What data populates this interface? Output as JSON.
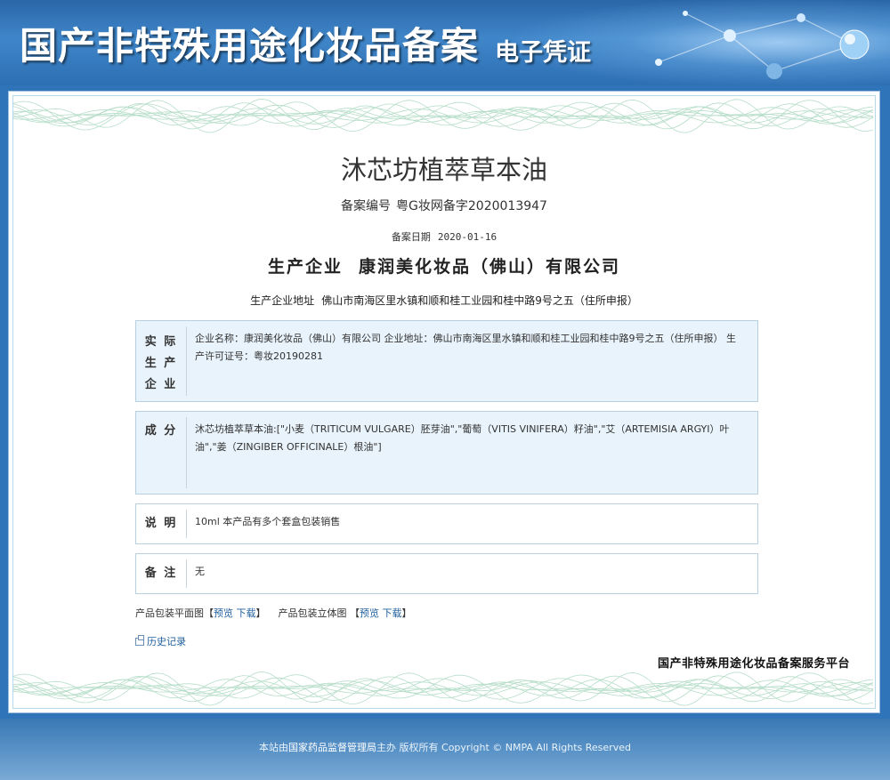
{
  "header": {
    "title": "国产非特殊用途化妆品备案",
    "subtitle": "电子凭证"
  },
  "product": {
    "name": "沐芯坊植萃草本油",
    "record_no_label": "备案编号",
    "record_no": "粤G妆网备字2020013947",
    "record_date_label": "备案日期",
    "record_date": "2020-01-16",
    "manufacturer_label": "生产企业",
    "manufacturer": "康润美化妆品（佛山）有限公司",
    "manufacturer_address_label": "生产企业地址",
    "manufacturer_address": "佛山市南海区里水镇和顺和桂工业园和桂中路9号之五（住所申报）"
  },
  "sections": {
    "actual_producer": {
      "label": "实际生产企业",
      "label_lines": [
        "实 际",
        "生 产",
        "企 业"
      ],
      "text": "企业名称：康润美化妆品（佛山）有限公司   企业地址：佛山市南海区里水镇和顺和桂工业园和桂中路9号之五（住所申报）   生产许可证号：粤妆20190281"
    },
    "ingredients": {
      "label": "成 分",
      "text": "沐芯坊植萃草本油:[\"小麦（TRITICUM VULGARE）胚芽油\",\"葡萄（VITIS VINIFERA）籽油\",\"艾（ARTEMISIA ARGYI）叶油\",\"姜（ZINGIBER OFFICINALE）根油\"]"
    },
    "description": {
      "label": "说 明",
      "text": "10ml 本产品有多个套盒包装销售"
    },
    "remarks": {
      "label": "备 注",
      "text": "无"
    }
  },
  "images": {
    "flat_label": "产品包装平面图",
    "solid_label": "产品包装立体图",
    "bracket_open": "【",
    "bracket_close": "】",
    "preview": "预览",
    "download": "下载"
  },
  "history_label": "历史记录",
  "platform_name": "国产非特殊用途化妆品备案服务平台",
  "footer": {
    "prefix": "本站由",
    "org": "国家药品监督管理局",
    "suffix": "主办 版权所有 Copyright © NMPA All Rights Reserved"
  },
  "colors": {
    "banner_blue": "#2f74b8",
    "box_blue": "#e8f3fb",
    "link_blue": "#1f5f9e"
  }
}
